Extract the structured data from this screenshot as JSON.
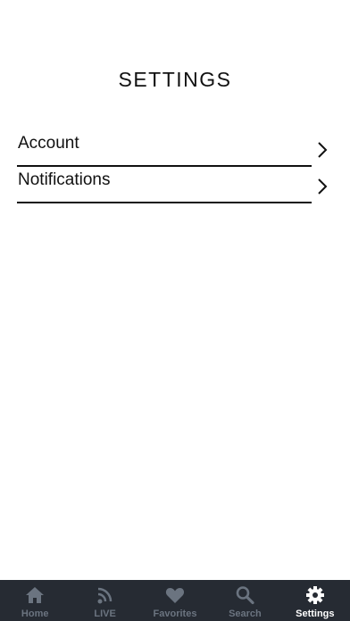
{
  "header": {
    "title": "SETTINGS"
  },
  "settings": {
    "items": [
      {
        "label": "Account",
        "icon": "chevron-right-icon"
      },
      {
        "label": "Notifications",
        "icon": "chevron-right-icon"
      }
    ]
  },
  "tab_bar": {
    "active": "Settings",
    "active_color": "#ffffff",
    "inactive_color": "#6b7480",
    "background": "#262b33",
    "tabs": [
      {
        "label": "Home",
        "icon": "home-icon"
      },
      {
        "label": "LIVE",
        "icon": "rss-feed-icon"
      },
      {
        "label": "Favorites",
        "icon": "heart-icon"
      },
      {
        "label": "Search",
        "icon": "search-icon"
      },
      {
        "label": "Settings",
        "icon": "gear-icon"
      }
    ]
  }
}
